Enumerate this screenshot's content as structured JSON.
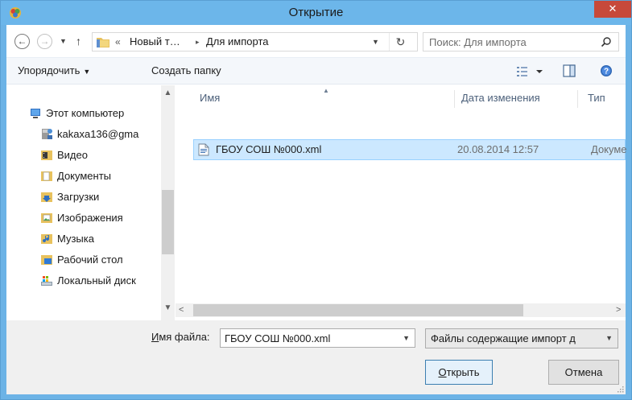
{
  "window": {
    "title": "Открытие",
    "close_label": "✕"
  },
  "address": {
    "chevrons": "«",
    "crumbs": [
      "Новый т…",
      "Для импорта"
    ],
    "separator": "▸"
  },
  "search": {
    "placeholder": "Поиск: Для импорта"
  },
  "toolbar": {
    "organize_label": "Упорядочить",
    "new_folder_label": "Создать папку"
  },
  "sidebar": {
    "items": [
      {
        "label": "Этот компьютер",
        "icon": "computer-icon"
      },
      {
        "label": "kakaxa136@gma",
        "icon": "network-user-icon"
      },
      {
        "label": "Видео",
        "icon": "video-folder-icon"
      },
      {
        "label": "Документы",
        "icon": "documents-folder-icon"
      },
      {
        "label": "Загрузки",
        "icon": "downloads-folder-icon"
      },
      {
        "label": "Изображения",
        "icon": "pictures-folder-icon"
      },
      {
        "label": "Музыка",
        "icon": "music-folder-icon"
      },
      {
        "label": "Рабочий стол",
        "icon": "desktop-folder-icon"
      },
      {
        "label": "Локальный диск",
        "icon": "local-disk-icon"
      }
    ]
  },
  "file_list": {
    "columns": {
      "name": "Имя",
      "date": "Дата изменения",
      "type": "Тип"
    },
    "files": [
      {
        "name": "ГБОУ СОШ №000.xml",
        "date": "20.08.2014 12:57",
        "type": "Докумен"
      }
    ]
  },
  "footer": {
    "filename_label_underlined": "И",
    "filename_label_rest": "мя файла:",
    "filename_value": "ГБОУ СОШ №000.xml",
    "filter_label": "Файлы содержащие импорт д",
    "open_underlined": "О",
    "open_rest": "ткрыть",
    "cancel_label": "Отмена"
  },
  "colors": {
    "title_bar": "#6cb6ea",
    "close_button": "#c7493a",
    "selection_fill": "#cce8ff",
    "selection_border": "#99d1ff"
  }
}
